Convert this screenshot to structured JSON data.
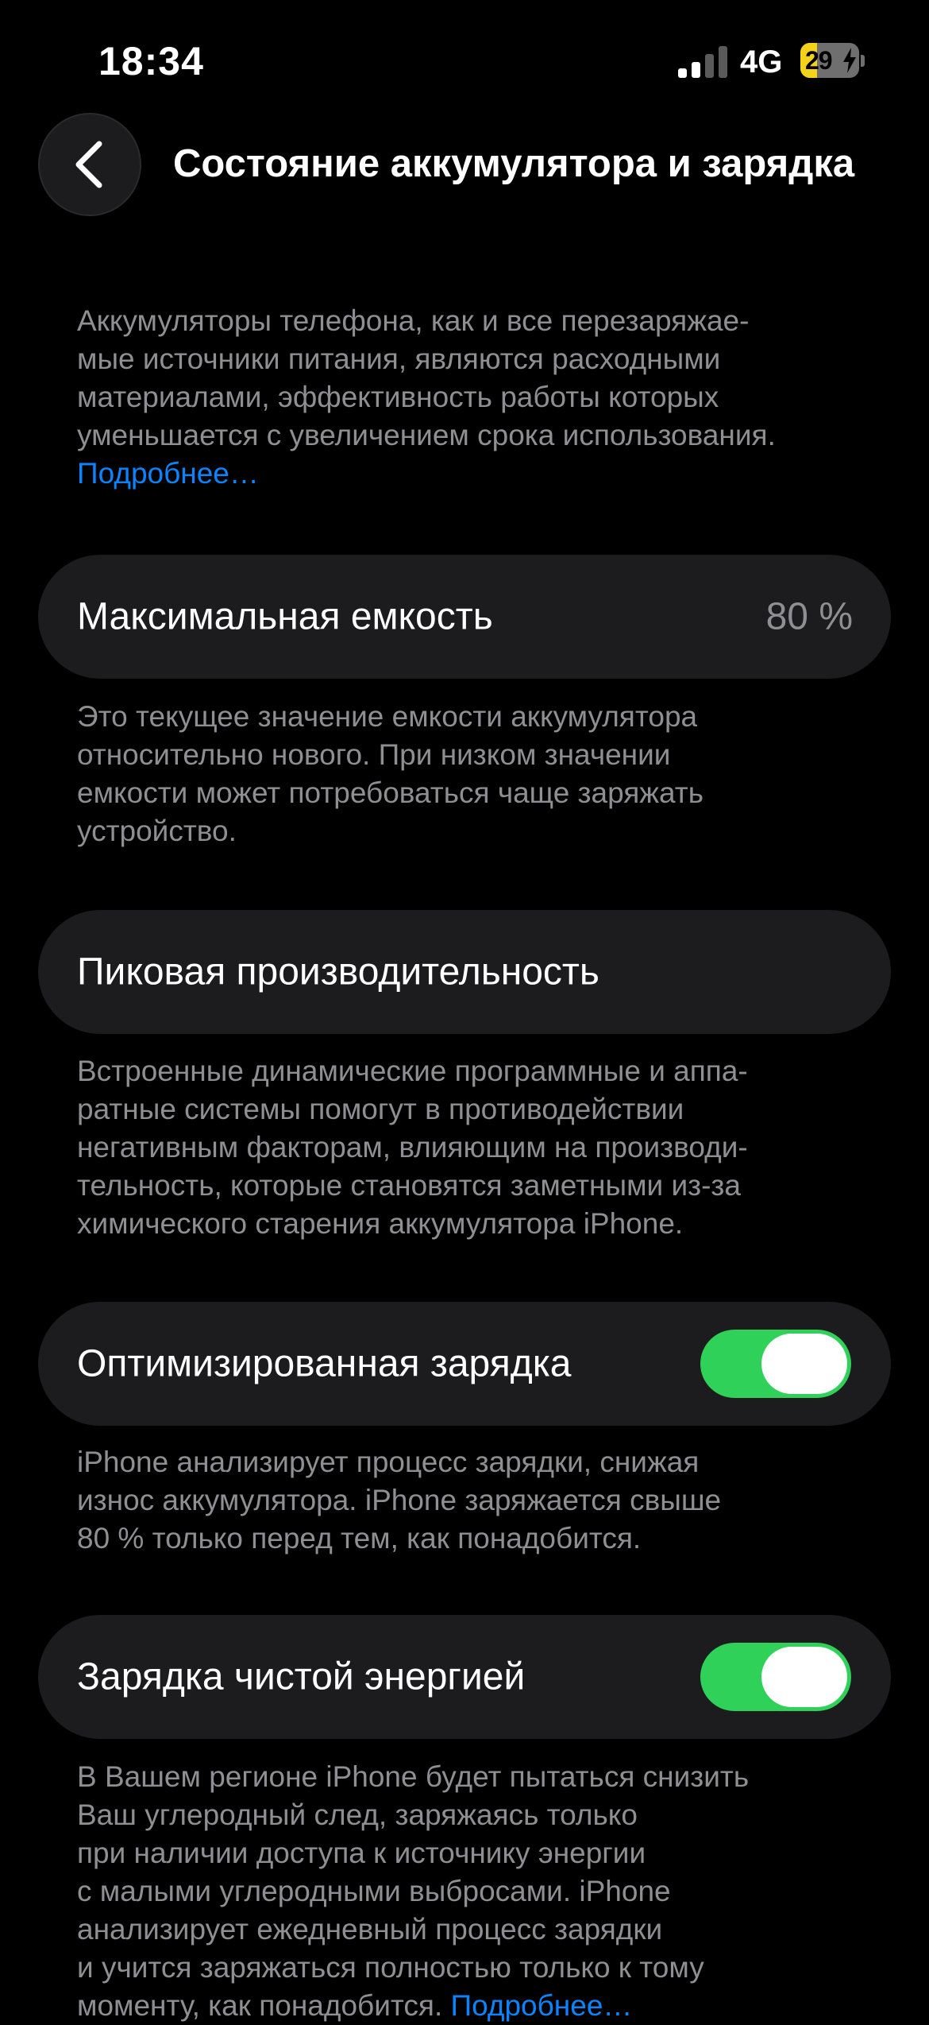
{
  "status_bar": {
    "time": "18:34",
    "network": "4G",
    "battery_percent": "29",
    "battery_level": 0.29,
    "charging": true
  },
  "header": {
    "title": "Состояние аккумулятора и зарядка"
  },
  "intro": {
    "lines": [
      "Аккумуляторы телефона, как и все перезаряжае-",
      "мые источники питания, являются расходными",
      "материалами, эффективность работы которых",
      "уменьшается с увеличением срока использования."
    ],
    "link": "Подробнее…"
  },
  "max_capacity": {
    "label": "Максимальная емкость",
    "value": "80 %",
    "description_lines": [
      "Это текущее значение емкости аккумулятора",
      "относительно нового. При низком значении",
      "емкости может потребоваться чаще заряжать",
      "устройство."
    ]
  },
  "peak_performance": {
    "label": "Пиковая производительность",
    "description_lines": [
      "Встроенные динамические программные и аппа-",
      "ратные системы помогут в противодействии",
      "негативным факторам, влияющим на производи-",
      "тельность, которые становятся заметными из-за",
      "химического старения аккумулятора iPhone."
    ]
  },
  "optimized_charging": {
    "label": "Оптимизированная зарядка",
    "enabled": true,
    "description_lines": [
      "iPhone анализирует процесс зарядки, снижая",
      "износ аккумулятора. iPhone заряжается свыше",
      "80 % только перед тем, как понадобится."
    ]
  },
  "clean_energy": {
    "label": "Зарядка чистой энергией",
    "enabled": true,
    "description_lines": [
      "В Вашем регионе iPhone будет пытаться снизить",
      "Ваш углеродный след, заряжаясь только",
      "при наличии доступа к источнику энергии",
      "с малыми углеродными выбросами. iPhone",
      "анализирует ежедневный процесс зарядки",
      "и учится заряжаться полностью только к тому"
    ],
    "last_line": "моменту, как понадобится.",
    "link": "Подробнее…"
  },
  "colors": {
    "background": "#000000",
    "cell": "#1c1c1e",
    "secondary_text": "#8e8e93",
    "link": "#0a84ff",
    "toggle_on": "#30d158",
    "battery_low": "#f5d21a"
  }
}
